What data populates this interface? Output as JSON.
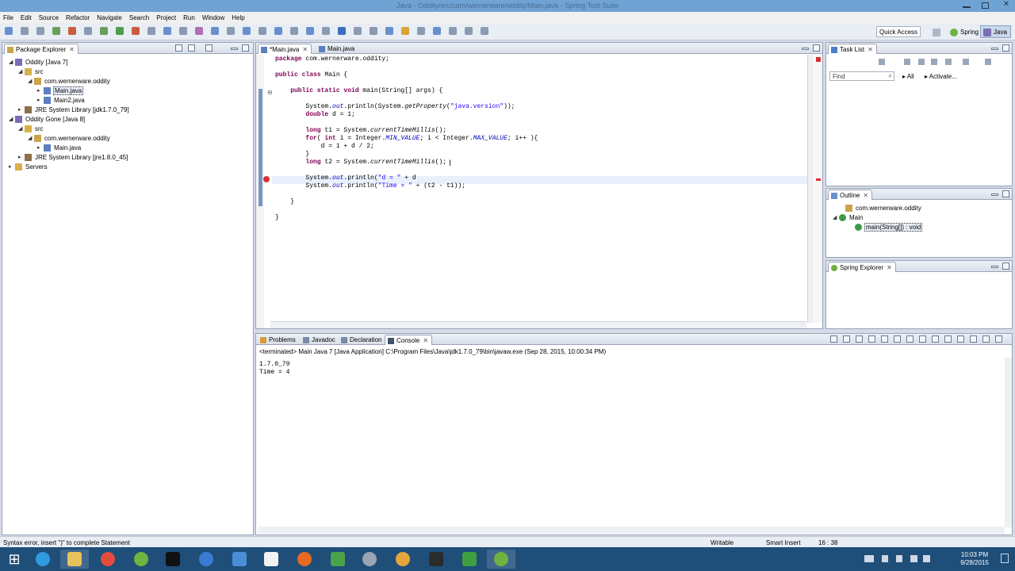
{
  "window": {
    "title": "Java - Oddity/src/com/wernerware/oddity/Main.java - Spring Tool Suite"
  },
  "menu": [
    "File",
    "Edit",
    "Source",
    "Refactor",
    "Navigate",
    "Search",
    "Project",
    "Run",
    "Window",
    "Help"
  ],
  "toolbar": {
    "quick_access": "Quick Access",
    "perspectives": [
      {
        "label": "Spring",
        "active": false
      },
      {
        "label": "Java",
        "active": true
      }
    ]
  },
  "package_explorer": {
    "tab": "Package Explorer",
    "tree": [
      {
        "label": "Oddity [Java 7]",
        "indent": 0,
        "icon": "project"
      },
      {
        "label": "src",
        "indent": 1,
        "icon": "folder"
      },
      {
        "label": "com.wernerware.oddity",
        "indent": 2,
        "icon": "package"
      },
      {
        "label": "Main.java",
        "indent": 3,
        "icon": "java-file",
        "selected": true
      },
      {
        "label": "Main2.java",
        "indent": 3,
        "icon": "java-file"
      },
      {
        "label": "JRE System Library [jdk1.7.0_79]",
        "indent": 1,
        "icon": "library"
      },
      {
        "label": "Oddity Gone [Java 8]",
        "indent": 0,
        "icon": "project"
      },
      {
        "label": "src",
        "indent": 1,
        "icon": "folder"
      },
      {
        "label": "com.wernerware.oddity",
        "indent": 2,
        "icon": "package"
      },
      {
        "label": "Main.java",
        "indent": 3,
        "icon": "java-file"
      },
      {
        "label": "JRE System Library [jre1.8.0_45]",
        "indent": 1,
        "icon": "library"
      },
      {
        "label": "Servers",
        "indent": 0,
        "icon": "folder"
      }
    ]
  },
  "editor": {
    "tabs": [
      {
        "label": "*Main.java",
        "active": true
      },
      {
        "label": "Main.java"
      }
    ],
    "lines": [
      [
        [
          "kw",
          "package"
        ],
        [
          "tx",
          " com.wernerware.oddity;"
        ]
      ],
      [
        [
          "tx",
          ""
        ]
      ],
      [
        [
          "kw",
          "public class"
        ],
        [
          "tx",
          " Main {"
        ]
      ],
      [
        [
          "tx",
          ""
        ]
      ],
      [
        [
          "tx",
          "    "
        ],
        [
          "kw",
          "public static void"
        ],
        [
          "tx",
          " main(String[] args) {"
        ]
      ],
      [
        [
          "tx",
          ""
        ]
      ],
      [
        [
          "tx",
          "        System."
        ],
        [
          "fld",
          "out"
        ],
        [
          "tx",
          ".println(System."
        ],
        [
          "sm",
          "getProperty"
        ],
        [
          "tx",
          "("
        ],
        [
          "str",
          "\"java.version\""
        ],
        [
          "tx",
          "));"
        ]
      ],
      [
        [
          "tx",
          "        "
        ],
        [
          "kw",
          "double"
        ],
        [
          "tx",
          " d = 1;"
        ]
      ],
      [
        [
          "tx",
          ""
        ]
      ],
      [
        [
          "tx",
          "        "
        ],
        [
          "kw",
          "long"
        ],
        [
          "tx",
          " t1 = System."
        ],
        [
          "sm",
          "currentTimeMillis"
        ],
        [
          "tx",
          "();"
        ]
      ],
      [
        [
          "tx",
          "        "
        ],
        [
          "kw",
          "for"
        ],
        [
          "tx",
          "( "
        ],
        [
          "kw",
          "int"
        ],
        [
          "tx",
          " i = Integer."
        ],
        [
          "fld",
          "MIN_VALUE"
        ],
        [
          "tx",
          "; i < Integer."
        ],
        [
          "fld",
          "MAX_VALUE"
        ],
        [
          "tx",
          "; i++ ){"
        ]
      ],
      [
        [
          "tx",
          "            d = 1 + d / 2;"
        ]
      ],
      [
        [
          "tx",
          "        }"
        ]
      ],
      [
        [
          "tx",
          "        "
        ],
        [
          "kw",
          "long"
        ],
        [
          "tx",
          " t2 = System."
        ],
        [
          "sm",
          "currentTimeMillis"
        ],
        [
          "tx",
          "();"
        ]
      ],
      [
        [
          "tx",
          ""
        ]
      ],
      [
        [
          "tx",
          "        System."
        ],
        [
          "fld",
          "out"
        ],
        [
          "tx",
          ".println("
        ],
        [
          "str",
          "\"d = \""
        ],
        [
          "tx",
          " + d"
        ]
      ],
      [
        [
          "tx",
          "        System."
        ],
        [
          "fld",
          "out"
        ],
        [
          "tx",
          ".println("
        ],
        [
          "str",
          "\"Time = \""
        ],
        [
          "tx",
          " + (t2 - t1));"
        ]
      ],
      [
        [
          "tx",
          ""
        ]
      ],
      [
        [
          "tx",
          "    }"
        ]
      ],
      [
        [
          "tx",
          ""
        ]
      ],
      [
        [
          "tx",
          "}"
        ]
      ]
    ]
  },
  "task_list": {
    "tab": "Task List",
    "find_placeholder": "Find",
    "all": "All",
    "activate": "Activate..."
  },
  "outline": {
    "tab": "Outline",
    "items": [
      "com.wernerware.oddity",
      "Main",
      "main(String[]) : void"
    ]
  },
  "spring_explorer": {
    "tab": "Spring Explorer"
  },
  "bottom_tabs": [
    {
      "label": "Problems"
    },
    {
      "label": "Javadoc"
    },
    {
      "label": "Declaration"
    },
    {
      "label": "Console",
      "active": true
    }
  ],
  "console": {
    "header": "<terminated> Main Java 7 [Java Application] C:\\Program Files\\Java\\jdk1.7.0_79\\bin\\javaw.exe (Sep 28, 2015, 10:00:34 PM)",
    "output": "1.7.0_79\nTime = 4"
  },
  "status": {
    "message": "Syntax error, insert \")\" to complete Statement",
    "writable": "Writable",
    "insert_mode": "Smart Insert",
    "position": "16 : 38"
  },
  "taskbar": {
    "time": "10:03 PM",
    "date": "9/28/2015"
  }
}
